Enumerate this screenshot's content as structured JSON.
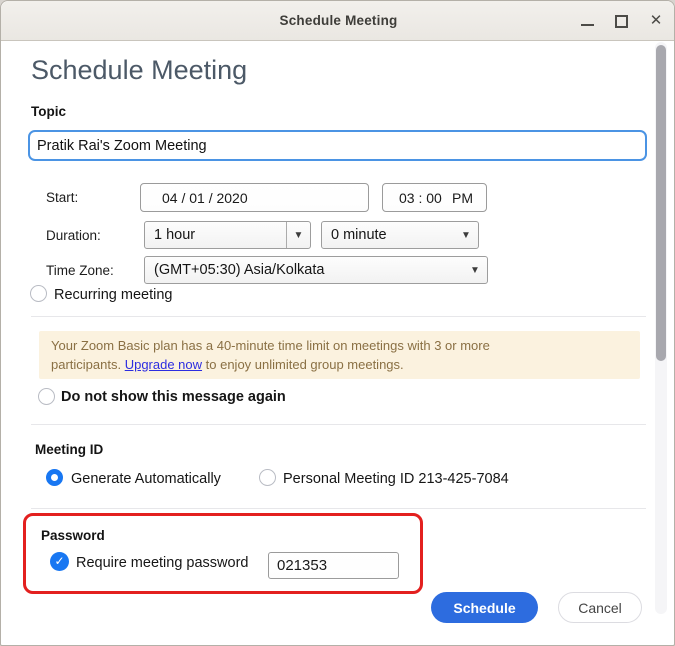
{
  "window": {
    "title": "Schedule Meeting"
  },
  "header": {
    "title": "Schedule Meeting"
  },
  "form": {
    "topic": {
      "label": "Topic",
      "value": "Pratik Rai's Zoom Meeting"
    },
    "start": {
      "label": "Start:",
      "date_value": "04 / 01 / 2020",
      "time_value": "03 : 00",
      "meridiem": "PM"
    },
    "duration": {
      "label": "Duration:",
      "hours_value": "1 hour",
      "minutes_value": "0 minute"
    },
    "timezone": {
      "label": "Time Zone:",
      "value": "(GMT+05:30) Asia/Kolkata"
    },
    "recurring": {
      "label": "Recurring meeting",
      "checked": false
    }
  },
  "notice": {
    "line1": "Your Zoom Basic plan has a 40-minute time limit on meetings with 3 or more",
    "line2_prefix": "participants. ",
    "link_label": "Upgrade now",
    "line2_suffix": " to enjoy unlimited group meetings.",
    "dismiss_label": "Do not show this message again",
    "background_color": "#fbf2df",
    "text_color": "#8a7044",
    "link_color": "#2d2de0"
  },
  "meeting_id": {
    "label": "Meeting ID",
    "options": [
      {
        "label": "Generate Automatically",
        "selected": true
      },
      {
        "label": "Personal Meeting ID 213-425-7084",
        "selected": false
      }
    ]
  },
  "password": {
    "label": "Password",
    "require_label": "Require meeting password",
    "checked": true,
    "value": "021353",
    "checkmark": "✓"
  },
  "actions": {
    "schedule_label": "Schedule",
    "cancel_label": "Cancel"
  },
  "annotation": {
    "type": "highlight-box around Password section",
    "color": "#e3201f"
  },
  "colors": {
    "accent_blue": "#1877f2",
    "button_blue": "#2d6cdf",
    "heading_gray_blue": "#4c5967",
    "titlebar": "#eeece7"
  }
}
